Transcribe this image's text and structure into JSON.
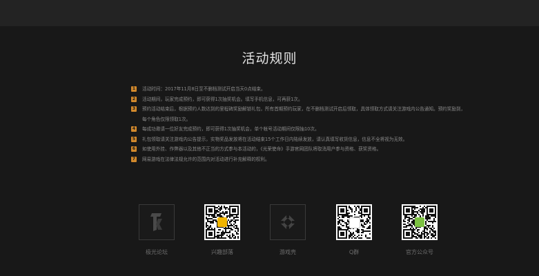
{
  "title": "活动规则",
  "rules": [
    {
      "num": "1",
      "text": "活动时间：2017年11月8日至不删档测试开启当天0点结束。"
    },
    {
      "num": "2",
      "text": "活动期间，玩家完成预约，即可获得1次抽奖机会。填写手机信息，可再获1次。"
    },
    {
      "num": "3",
      "text": "预约活动结束后，根据预约人数达到的里程碑奖励解锁礼包，所有首期预约玩家，在不删档测试开启后领取，具体领取方式请关注游戏内公告通知。预约奖励到，每个角色仅限领取1次。"
    },
    {
      "num": "4",
      "text": "每成功邀请一位好友完成预约，即可获得1次抽奖机会，单个帐号活动期间仅限抽10次。"
    },
    {
      "num": "5",
      "text": "礼包领取请关注游戏内公告提示，实物奖品发放将在活动结束15个工作日内陆续发放，请认真填写收货信息，信息不全将视为无效。"
    },
    {
      "num": "6",
      "text": "如使用外挂、作弊器以及其他不正当的方式参与本活动的，《光荣使命》手游官网团队将取消用户参与资格、获奖资格。"
    },
    {
      "num": "7",
      "text": "网易游戏在法律法规允许的范围内对活动进行补充解释的权利。"
    }
  ],
  "footer": [
    {
      "label": "极光论坛",
      "kind": "icon",
      "icon": "forum-logo-icon"
    },
    {
      "label": "兴趣部落",
      "kind": "qr",
      "center_color": "#f0b400"
    },
    {
      "label": "游戏壳",
      "kind": "icon",
      "icon": "game-shell-logo-icon"
    },
    {
      "label": "Q群",
      "kind": "qr",
      "center_color": "#ffffff"
    },
    {
      "label": "官方公众号",
      "kind": "qr",
      "center_color": "#7cc242"
    }
  ],
  "colors": {
    "accent": "#d2892c",
    "background": "#181818",
    "topbar": "#232323"
  }
}
